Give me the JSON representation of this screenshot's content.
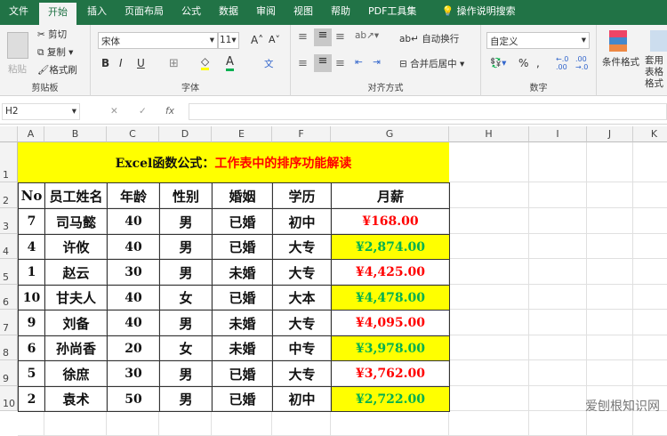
{
  "tabs": [
    "文件",
    "开始",
    "插入",
    "页面布局",
    "公式",
    "数据",
    "审阅",
    "视图",
    "帮助",
    "PDF工具集"
  ],
  "search": {
    "icon": "lightbulb-icon",
    "label": "操作说明搜索"
  },
  "ribbon": {
    "clipboard": {
      "paste": "粘贴",
      "cut": "剪切",
      "copy": "复制",
      "format_painter": "格式刷",
      "label": "剪贴板"
    },
    "font": {
      "name": "宋体",
      "size": "11",
      "bold": "B",
      "italic": "I",
      "underline": "U",
      "label": "字体",
      "fill_color": "#ffff00",
      "font_color": "#00b050"
    },
    "alignment": {
      "wrap": "自动换行",
      "merge": "合并后居中",
      "label": "对齐方式"
    },
    "number": {
      "format": "自定义",
      "percent": "%",
      "comma": ",",
      "label": "数字"
    },
    "styles": {
      "conditional": "条件格式",
      "table": "套用表格格式"
    }
  },
  "formula_bar": {
    "name_box": "H2",
    "fx": "fx",
    "value": ""
  },
  "columns": [
    "A",
    "B",
    "C",
    "D",
    "E",
    "F",
    "G",
    "H",
    "I",
    "J",
    "K"
  ],
  "rows": [
    "1",
    "2",
    "3",
    "4",
    "5",
    "6",
    "7",
    "8",
    "9",
    "10"
  ],
  "title": {
    "black": "Excel函数公式：",
    "red": "工作表中的排序功能解读"
  },
  "headers": [
    "No",
    "员工姓名",
    "年龄",
    "性别",
    "婚姻",
    "学历",
    "月薪"
  ],
  "data": [
    [
      "7",
      "司马懿",
      "40",
      "男",
      "已婚",
      "初中",
      "¥168.00"
    ],
    [
      "4",
      "许攸",
      "40",
      "男",
      "已婚",
      "大专",
      "¥2,874.00"
    ],
    [
      "1",
      "赵云",
      "30",
      "男",
      "未婚",
      "大专",
      "¥4,425.00"
    ],
    [
      "10",
      "甘夫人",
      "40",
      "女",
      "已婚",
      "大本",
      "¥4,478.00"
    ],
    [
      "9",
      "刘备",
      "40",
      "男",
      "未婚",
      "大专",
      "¥4,095.00"
    ],
    [
      "6",
      "孙尚香",
      "20",
      "女",
      "未婚",
      "中专",
      "¥3,978.00"
    ],
    [
      "5",
      "徐庶",
      "30",
      "男",
      "已婚",
      "大专",
      "¥3,762.00"
    ],
    [
      "2",
      "袁术",
      "50",
      "男",
      "已婚",
      "初中",
      "¥2,722.00"
    ]
  ],
  "colors": {
    "accent": "#217346",
    "highlight": "#ffff00",
    "red": "#ff0000",
    "green": "#00b050"
  },
  "watermark": "爱刨根知识网"
}
